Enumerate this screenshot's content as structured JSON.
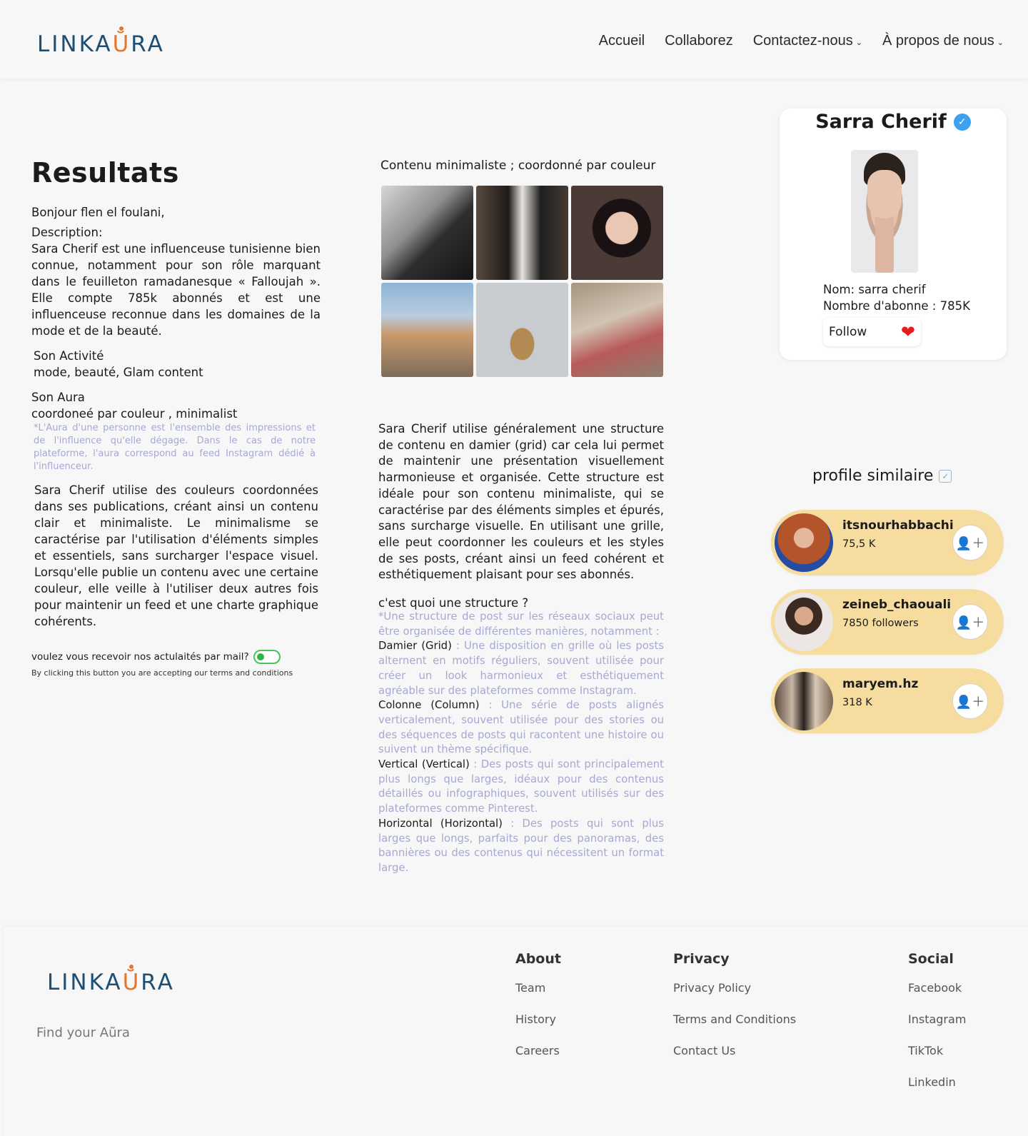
{
  "brand": {
    "logo_pre": "LINKA",
    "logo_mark": "Ŭ",
    "logo_post": "RA"
  },
  "nav": {
    "items": [
      {
        "label": "Accueil",
        "dropdown": false
      },
      {
        "label": "Collaborez",
        "dropdown": false
      },
      {
        "label": "Contactez-nous",
        "dropdown": true
      },
      {
        "label": "À propos de nous",
        "dropdown": true
      }
    ]
  },
  "results": {
    "title": "Resultats",
    "greeting": "Bonjour flen el foulani,",
    "description_label": "Description:",
    "description": "Sara Cherif est une influenceuse tunisienne bien connue, notamment pour son rôle marquant dans le feuilleton ramadanesque « Falloujah ». Elle compte 785k abonnés et est une influenceuse reconnue dans les domaines de la mode et de la beauté.",
    "activity_label": "Son Activité",
    "activity": "mode, beauté, Glam content",
    "aura_label": "Son Aura",
    "aura": "coordoneé par couleur , minimalist",
    "aura_note": "*L'Aura d'une personne est l'ensemble des impressions et de l'influence qu'elle dégage. Dans le cas de notre plateforme, l'aura correspond au feed Instagram dédié à l'influenceur.",
    "color_paragraph": "Sara Cherif utilise des couleurs coordonnées dans ses publications, créant ainsi un contenu clair et minimaliste. Le minimalisme se caractérise par l'utilisation d'éléments simples et essentiels, sans surcharger l'espace visuel. Lorsqu'elle publie un contenu avec une certaine couleur, elle veille à l'utiliser deux autres fois pour maintenir un feed et une charte graphique cohérents.",
    "newsletter_label": "voulez vous recevoir nos actulaités par mail?",
    "newsletter_on": true,
    "terms": "By clicking this button you are accepting our terms and conditions"
  },
  "feed": {
    "caption": "Contenu minimaliste ; coordonné par couleur",
    "body": "Sara Cherif utilise généralement une structure de contenu en damier (grid) car cela lui permet de maintenir une présentation visuellement harmonieuse et organisée. Cette structure est idéale pour son contenu minimaliste, qui se caractérise par des éléments simples et épurés, sans surcharge visuelle. En utilisant une grille, elle peut coordonner les couleurs et les styles de ses posts, créant ainsi un feed cohérent et esthétiquement plaisant pour ses abonnés.",
    "structure_q": "c'est quoi une structure ?",
    "structure_intro": "*Une structure de post sur les réseaux sociaux peut être organisée de différentes manières, notamment :",
    "structures": [
      {
        "key": "Damier (Grid)",
        "text": " : Une disposition en grille où les posts alternent en motifs réguliers, souvent utilisée pour créer un look harmonieux et esthétiquement agréable sur des plateformes comme Instagram."
      },
      {
        "key": "Colonne (Column)",
        "text": " : Une série de posts alignés verticalement, souvent utilisée pour des stories ou des séquences de posts qui racontent une histoire ou suivent un thème spécifique."
      },
      {
        "key": "Vertical (Vertical)",
        "text": " : Des posts qui sont principalement plus longs que larges, idéaux pour des contenus détaillés ou infographiques, souvent utilisés sur des plateformes comme Pinterest."
      },
      {
        "key": "Horizontal (Horizontal)",
        "text": " : Des posts qui sont plus larges que longs, parfaits pour des panoramas, des bannières ou des contenus qui nécessitent un format large."
      }
    ]
  },
  "profile": {
    "name": "Sarra Cherif",
    "name_line": "Nom: sarra cherif",
    "subscribers_line": "Nombre d'abonne : 785K",
    "follow_label": "Follow"
  },
  "similar": {
    "title": "profile similaire",
    "items": [
      {
        "name": "itsnourhabbachi",
        "count": "75,5 K"
      },
      {
        "name": "zeineb_chaouali",
        "count": "7850 followers"
      },
      {
        "name": "maryem.hz",
        "count": "318 K"
      }
    ]
  },
  "footer": {
    "tagline": "Find your Aũra",
    "columns": [
      {
        "title": "About",
        "links": [
          "Team",
          "History",
          "Careers"
        ]
      },
      {
        "title": "Privacy",
        "links": [
          "Privacy Policy",
          "Terms and Conditions",
          "Contact Us"
        ]
      },
      {
        "title": "Social",
        "links": [
          "Facebook",
          "Instagram",
          "TikTok",
          "Linkedin"
        ]
      }
    ]
  },
  "colors": {
    "brand": "#1d4f74",
    "accent": "#e8742a",
    "muted_text": "#a5a9d2",
    "similar_bg": "#f6dc9f",
    "toggle_on": "#2db646",
    "heart": "#e61c1c"
  }
}
